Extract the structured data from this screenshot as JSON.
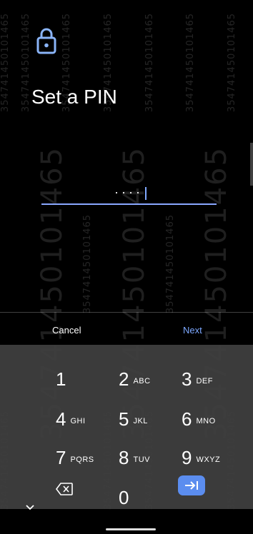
{
  "watermark": {
    "code": "354741450101465"
  },
  "screen": {
    "title": "Set a PIN",
    "pin_value": "····"
  },
  "actions": {
    "cancel": "Cancel",
    "next": "Next"
  },
  "keypad": [
    {
      "num": "1",
      "letters": ""
    },
    {
      "num": "2",
      "letters": "ABC"
    },
    {
      "num": "3",
      "letters": "DEF"
    },
    {
      "num": "4",
      "letters": "GHI"
    },
    {
      "num": "5",
      "letters": "JKL"
    },
    {
      "num": "6",
      "letters": "MNO"
    },
    {
      "num": "7",
      "letters": "PQRS"
    },
    {
      "num": "8",
      "letters": "TUV"
    },
    {
      "num": "9",
      "letters": "WXYZ"
    },
    {
      "num": "0",
      "letters": ""
    }
  ],
  "icons": {
    "lock": "lock-icon",
    "backspace": "backspace-icon",
    "go": "next-field-icon",
    "collapse": "chevron-down-icon"
  },
  "colors": {
    "accent": "#7da8ff",
    "go_button": "#5b8def",
    "keyboard_bg": "#404040"
  }
}
